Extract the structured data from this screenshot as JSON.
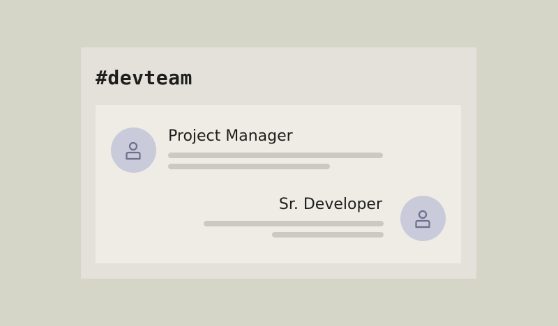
{
  "channel": {
    "name": "#devteam"
  },
  "messages": [
    {
      "author": "Project Manager",
      "avatar_icon": "user-icon",
      "alignment": "left"
    },
    {
      "author": "Sr. Developer",
      "avatar_icon": "user-icon",
      "alignment": "right"
    }
  ],
  "colors": {
    "background": "#d6d6c8",
    "card": "#e3e1da",
    "panel": "#eeece5",
    "avatar": "#c9cada",
    "avatar_icon": "#6e6f8a",
    "placeholder_line": "#cbc9c4",
    "text": "#1e1e1c"
  }
}
